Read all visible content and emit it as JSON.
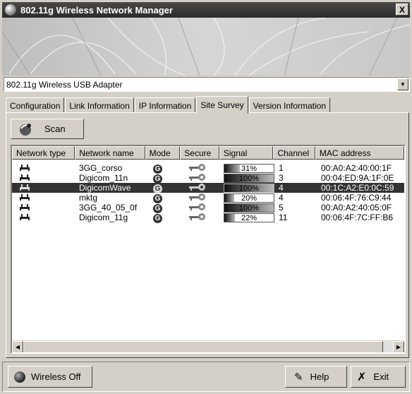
{
  "window": {
    "title": "802.11g Wireless Network Manager",
    "close_label": "X"
  },
  "adapter": {
    "selected": "802.11g Wireless USB Adapter"
  },
  "tabs": [
    {
      "label": "Configuration"
    },
    {
      "label": "Link Information"
    },
    {
      "label": "IP Information"
    },
    {
      "label": "Site Survey",
      "active": true
    },
    {
      "label": "Version Information"
    }
  ],
  "toolbar": {
    "scan_label": "Scan"
  },
  "columns": [
    "Network type",
    "Network name",
    "Mode",
    "Secure",
    "Signal",
    "Channel",
    "MAC address"
  ],
  "networks": [
    {
      "name": "3GG_corso",
      "mode": "G",
      "signal": "31%",
      "signal_value": 31,
      "channel": "1",
      "mac": "00:A0:A2:40:00:1F"
    },
    {
      "name": "Digicom_11n",
      "mode": "G",
      "signal": "100%",
      "signal_value": 100,
      "channel": "3",
      "mac": "00:04:ED:9A:1F:0E"
    },
    {
      "name": "DigicomWave",
      "mode": "G",
      "signal": "100%",
      "signal_value": 100,
      "channel": "4",
      "mac": "00:1C:A2:E0:0C:59",
      "selected": true
    },
    {
      "name": "mktg",
      "mode": "G",
      "signal": "20%",
      "signal_value": 20,
      "channel": "4",
      "mac": "00:06:4F:76:C9:44"
    },
    {
      "name": "3GG_40_05_0f",
      "mode": "G",
      "signal": "100%",
      "signal_value": 100,
      "channel": "5",
      "mac": "00:A0:A2:40:05:0F"
    },
    {
      "name": "Digicom_11g",
      "mode": "G",
      "signal": "22%",
      "signal_value": 22,
      "channel": "11",
      "mac": "00:06:4F:7C:FF:B6"
    }
  ],
  "footer": {
    "wireless_off_label": "Wireless Off",
    "help_label": "Help",
    "exit_label": "Exit"
  }
}
